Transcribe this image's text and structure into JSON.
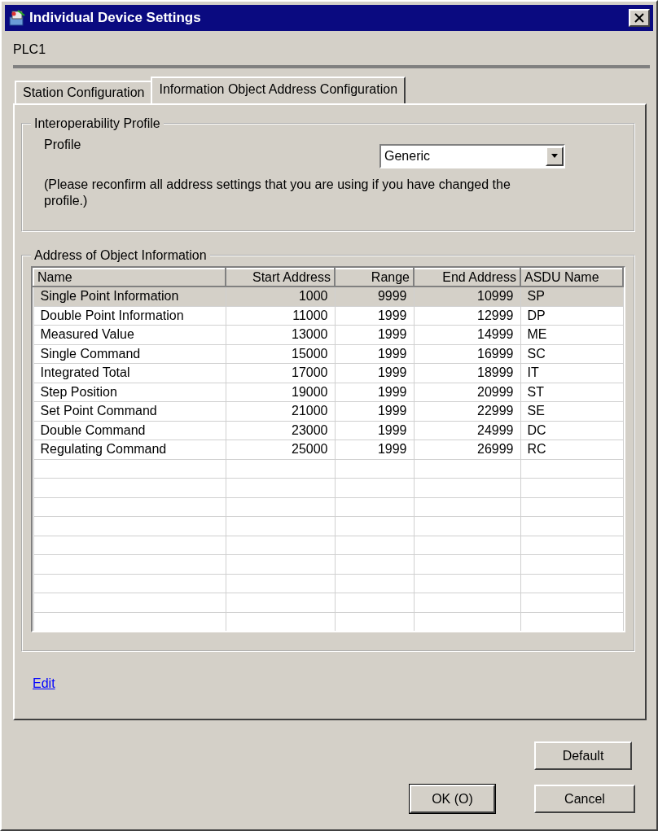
{
  "window": {
    "title": "Individual Device Settings"
  },
  "device": "PLC1",
  "tabs": [
    {
      "label": "Station Configuration",
      "selected": false
    },
    {
      "label": "Information Object Address Configuration",
      "selected": true
    }
  ],
  "profile_group": {
    "title": "Interoperability Profile",
    "label": "Profile",
    "value": "Generic",
    "note": "(Please reconfirm all address settings that you are using if you have changed the profile.)"
  },
  "address_group": {
    "title": "Address of Object Information"
  },
  "table": {
    "columns": [
      "Name",
      "Start Address",
      "Range",
      "End Address",
      "ASDU Name"
    ],
    "rows": [
      {
        "cells": [
          "Single Point Information",
          "1000",
          "9999",
          "10999",
          "SP"
        ],
        "selected": true
      },
      {
        "cells": [
          "Double Point Information",
          "11000",
          "1999",
          "12999",
          "DP"
        ],
        "selected": false
      },
      {
        "cells": [
          "Measured Value",
          "13000",
          "1999",
          "14999",
          "ME"
        ],
        "selected": false
      },
      {
        "cells": [
          "Single Command",
          "15000",
          "1999",
          "16999",
          "SC"
        ],
        "selected": false
      },
      {
        "cells": [
          "Integrated Total",
          "17000",
          "1999",
          "18999",
          "IT"
        ],
        "selected": false
      },
      {
        "cells": [
          "Step Position",
          "19000",
          "1999",
          "20999",
          "ST"
        ],
        "selected": false
      },
      {
        "cells": [
          "Set Point Command",
          "21000",
          "1999",
          "22999",
          "SE"
        ],
        "selected": false
      },
      {
        "cells": [
          "Double Command",
          "23000",
          "1999",
          "24999",
          "DC"
        ],
        "selected": false
      },
      {
        "cells": [
          "Regulating Command",
          "25000",
          "1999",
          "26999",
          "RC"
        ],
        "selected": false
      }
    ]
  },
  "edit_link": "Edit",
  "buttons": {
    "default": "Default",
    "ok": "OK (O)",
    "cancel": "Cancel"
  }
}
